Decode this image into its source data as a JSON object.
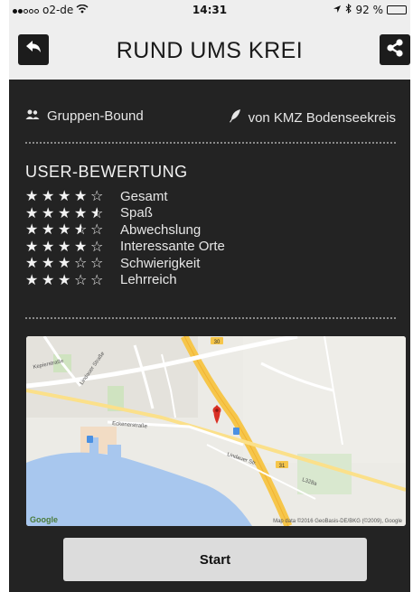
{
  "status_bar": {
    "carrier": "o2-de",
    "time": "14:31",
    "battery_percent": "92 %",
    "battery_level": 0.92
  },
  "header": {
    "title": "RUND UMS KREI",
    "back_icon": "back-arrow-icon",
    "share_icon": "share-icon"
  },
  "info": {
    "group": "Gruppen-Bound",
    "author": "von KMZ Bodenseekreis"
  },
  "ratings": {
    "title": "USER-BEWERTUNG",
    "items": [
      {
        "label": "Gesamt",
        "stars": 4
      },
      {
        "label": "Spaß",
        "stars": 4.5
      },
      {
        "label": "Abwechslung",
        "stars": 3.5
      },
      {
        "label": "Interessante Orte",
        "stars": 4
      },
      {
        "label": "Schwierigkeit",
        "stars": 3
      },
      {
        "label": "Lehrreich",
        "stars": 3
      }
    ]
  },
  "map": {
    "provider": "Google",
    "credit": "Map data ©2016 GeoBasis-DE/BKG (©2009), Google",
    "streets": [
      "Kepierstraße",
      "Lindauer Straße",
      "Eckenerstraße",
      "Lindauer Str.",
      "L328a"
    ],
    "road_numbers": [
      "30",
      "31"
    ]
  },
  "actions": {
    "start_label": "Start"
  },
  "colors": {
    "background": "#232323",
    "header_bg": "#eeeeee",
    "button_bg": "#dcdcdc",
    "pin": "#d93025"
  }
}
